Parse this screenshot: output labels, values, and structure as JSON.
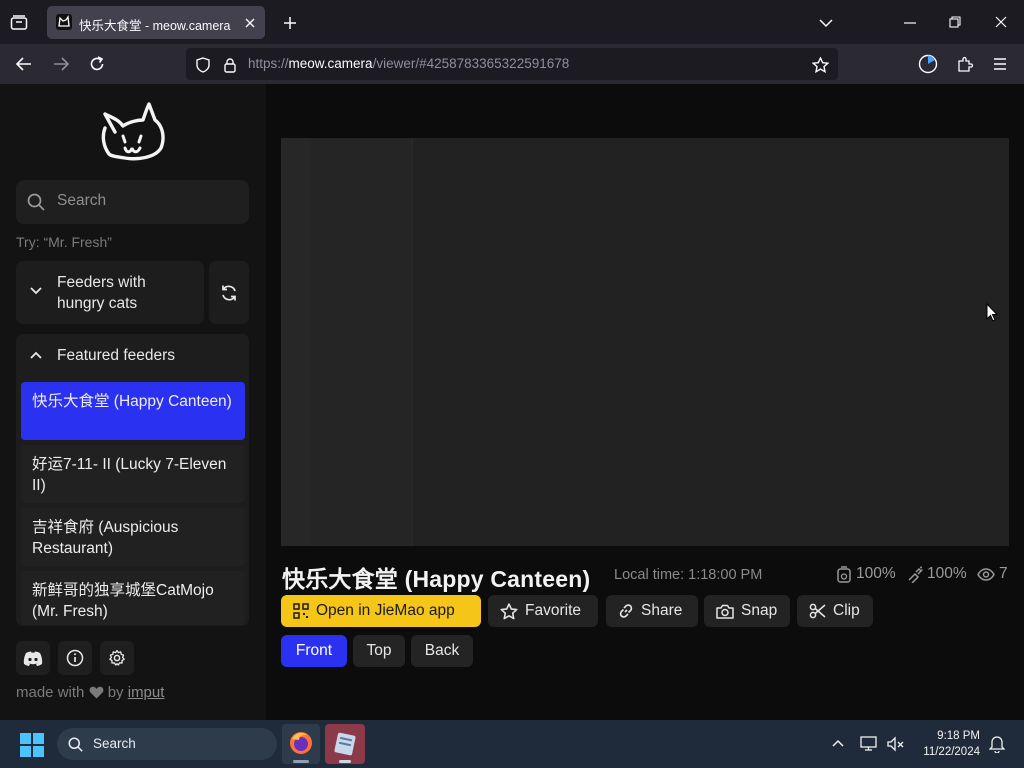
{
  "browser": {
    "tab_title": "快乐大食堂 - meow.camera",
    "url_prefix": "https://",
    "url_host": "meow.camera",
    "url_path": "/viewer/#4258783365322591678"
  },
  "sidebar": {
    "search_placeholder": "Search",
    "try_hint": "Try: “Mr. Fresh”",
    "hungry_panel_label": "Feeders with hungry cats",
    "featured_panel_label": "Featured feeders",
    "feeders": [
      {
        "label": "快乐大食堂 (Happy Canteen)",
        "active": true
      },
      {
        "label": "好运7-11- II  (Lucky 7-Eleven II)",
        "active": false
      },
      {
        "label": "吉祥食府 (Auspicious Restaurant)",
        "active": false
      },
      {
        "label": "新鲜哥的独享城堡CatMojo (Mr. Fresh)",
        "active": false
      }
    ],
    "made_with": "made with",
    "by": "by",
    "author": "imput"
  },
  "camera": {
    "title": "快乐大食堂 (Happy Canteen)",
    "local_time": "Local time: 1:18:00 PM",
    "food_level": "100%",
    "clean_level": "100%",
    "viewers": "7"
  },
  "actions": {
    "open_app": "Open in JieMao app",
    "favorite": "Favorite",
    "share": "Share",
    "snap": "Snap",
    "clip": "Clip"
  },
  "views": [
    "Front",
    "Top",
    "Back"
  ],
  "active_view": "Front",
  "taskbar": {
    "search_label": "Search",
    "time": "9:18 PM",
    "date": "11/22/2024"
  },
  "colors": {
    "accent": "#2b31f0",
    "app_button": "#f5c518"
  }
}
